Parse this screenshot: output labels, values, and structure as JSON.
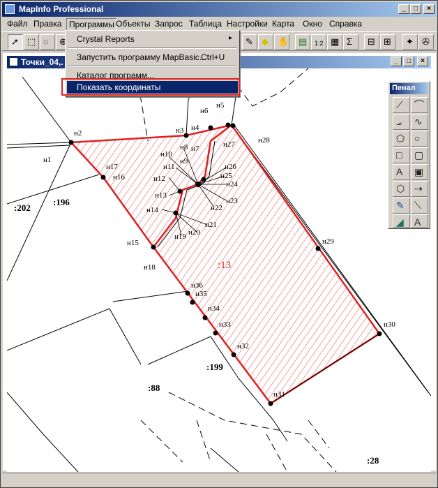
{
  "app": {
    "title": "MapInfo Professional",
    "accent": "#0a246a"
  },
  "window_buttons": {
    "minimize": "_",
    "maximize": "□",
    "close": "×"
  },
  "menubar": {
    "items": [
      "Файл",
      "Правка",
      "Программы",
      "Объекты",
      "Запрос",
      "Таблица",
      "Настройки",
      "Карта",
      "Окно",
      "Справка"
    ],
    "active_index": 2
  },
  "dropdown": {
    "items": [
      {
        "label": "Crystal Reports",
        "accel": "",
        "submenu": "▸"
      },
      {
        "label": "Запустить программу MapBasic...",
        "accel": "Ctrl+U",
        "submenu": ""
      },
      {
        "label": "Каталог программ...",
        "accel": "",
        "submenu": ""
      },
      {
        "label": "Показать координаты",
        "accel": "",
        "submenu": ""
      }
    ],
    "selected_index": 3,
    "highlight_color": "#e02020"
  },
  "toolbar": {
    "icons": [
      "arrow-icon",
      "marquee-select-icon",
      "radius-select-icon",
      "zoom-in-icon",
      "pencil-icon",
      "label-icon",
      "grabber-icon",
      "layer-control-icon",
      "ruler-icon",
      "info-icon",
      "sum-icon",
      "statistics-icon",
      "legend-icon",
      "redistrict-icon",
      "run-icon"
    ]
  },
  "document": {
    "title": "Точки_04,.",
    "buttons": {
      "minimize": "_",
      "maximize": "□",
      "close": "×"
    }
  },
  "penal": {
    "title": "Пенал",
    "tools": [
      "line-icon",
      "arc-icon",
      "polyline-icon",
      "curve-icon",
      "polygon-icon",
      "ellipse-icon",
      "rectangle-icon",
      "rounded-rect-icon",
      "text-icon",
      "frame-icon",
      "reshape-icon",
      "add-node-icon",
      "symbol-style-icon",
      "line-style-icon",
      "region-style-icon",
      "text-style-icon"
    ],
    "text_glyph": "A"
  },
  "map": {
    "parcel_main_label": ":13",
    "parcel_labels": [
      ":202",
      ":196",
      ":199",
      ":88",
      ":28"
    ],
    "points": [
      "н1",
      "н2",
      "н3",
      "н4",
      "н5",
      "н6",
      "н7",
      "н8",
      "н9",
      "н10",
      "н11",
      "н12",
      "н13",
      "н14",
      "н15",
      "н16",
      "н17",
      "н18",
      "н19",
      "н20",
      "н21",
      "н22",
      "н23",
      "н24",
      "н25",
      "н26",
      "н27",
      "н28",
      "н29",
      "н30",
      "н31",
      "н32",
      "н33",
      "н34",
      "н35",
      "н36"
    ],
    "parcel_color": "#e02020"
  }
}
